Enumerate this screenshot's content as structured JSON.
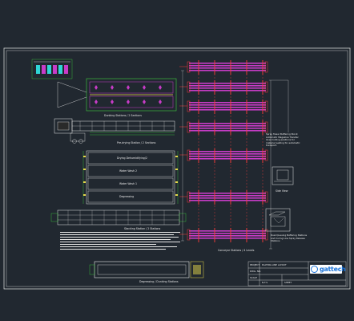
{
  "drawing": {
    "colors": {
      "background": "#212830",
      "frame": "#e8e8e8",
      "outline": "#3fd13f",
      "conveyor_body": "#c83cc8",
      "conveyor_rail": "#ff3b3b",
      "dimension": "#e8e8e8",
      "accent_yellow": "#e6d84a",
      "accent_cyan": "#2fd5d5"
    },
    "section_titles": {
      "top_equipment": "Dunking Stations / 2 Sections",
      "middle": "Pre-drying Station / 2 Sections",
      "lower_rack": "Stacking Station / 2 Stations",
      "bottom": "Degreasing / Dunking Stations",
      "conveyors": "Conveyor Stations / 4 Levels"
    },
    "oven_levels": [
      "Drying Dehumidifying/2",
      "Water Wash 2",
      "Water Wash 1",
      "Degreasing"
    ],
    "side_view_label": "Side View",
    "notes": {
      "note_a": "Spray Tower Buffering Stock: Automatic Magazine Transfer lines holding positions for material waiting for automatic transport.",
      "note_b": "Dual Queuing Buffering Stations and Curing Line Spray Release Stations"
    },
    "title_block": {
      "project_label": "PROJECT",
      "project_value": "PLATING LINE LAYOUT",
      "dwg_label": "DWG. NO.",
      "scale_label": "SCALE",
      "scale_value": "N.T.S",
      "sheet_label": "SHEET"
    },
    "logo_text": "gattech"
  }
}
